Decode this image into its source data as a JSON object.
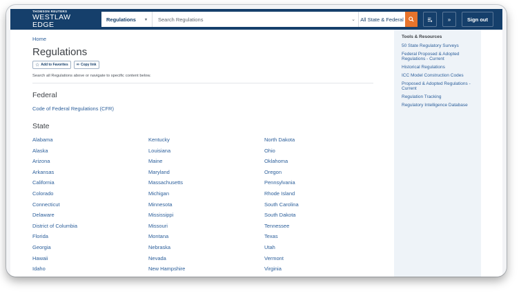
{
  "header": {
    "brand_top": "THOMSON REUTERS",
    "brand_main": "WESTLAW EDGE",
    "category": "Regulations",
    "search_placeholder": "Search Regulations",
    "scope": "All State & Federal",
    "sign_out": "Sign out"
  },
  "main": {
    "breadcrumb": "Home",
    "title": "Regulations",
    "add_favorites": "Add to Favorites",
    "copy_link": "Copy link",
    "hint": "Search all Regulations above or navigate to specific content below.",
    "federal_heading": "Federal",
    "federal_link": "Code of Federal Regulations (CFR)",
    "state_heading": "State",
    "states": [
      "Alabama",
      "Kentucky",
      "North Dakota",
      "Alaska",
      "Louisiana",
      "Ohio",
      "Arizona",
      "Maine",
      "Oklahoma",
      "Arkansas",
      "Maryland",
      "Oregon",
      "California",
      "Massachusetts",
      "Pennsylvania",
      "Colorado",
      "Michigan",
      "Rhode Island",
      "Connecticut",
      "Minnesota",
      "South Carolina",
      "Delaware",
      "Mississippi",
      "South Dakota",
      "District of Columbia",
      "Missouri",
      "Tennessee",
      "Florida",
      "Montana",
      "Texas",
      "Georgia",
      "Nebraska",
      "Utah",
      "Hawaii",
      "Nevada",
      "Vermont",
      "Idaho",
      "New Hampshire",
      "Virginia"
    ]
  },
  "tools": {
    "title": "Tools & Resources",
    "items": [
      "50 State Regulatory Surveys",
      "Federal Proposed & Adopted Regulations - Current",
      "Historical Regulations",
      "ICC Model Construction Codes",
      "Proposed & Adopted Regulations - Current",
      "Regulation Tracking",
      "Regulatory Intelligence Database"
    ]
  },
  "colors": {
    "header_bg": "#153f6b",
    "link": "#2b5e9a",
    "search_button": "#e8742c",
    "panel_bg": "#eef3f8"
  },
  "icons": [
    "chevron-down-icon",
    "search-icon",
    "history-icon",
    "double-chevron-icon",
    "star-icon",
    "link-icon"
  ]
}
